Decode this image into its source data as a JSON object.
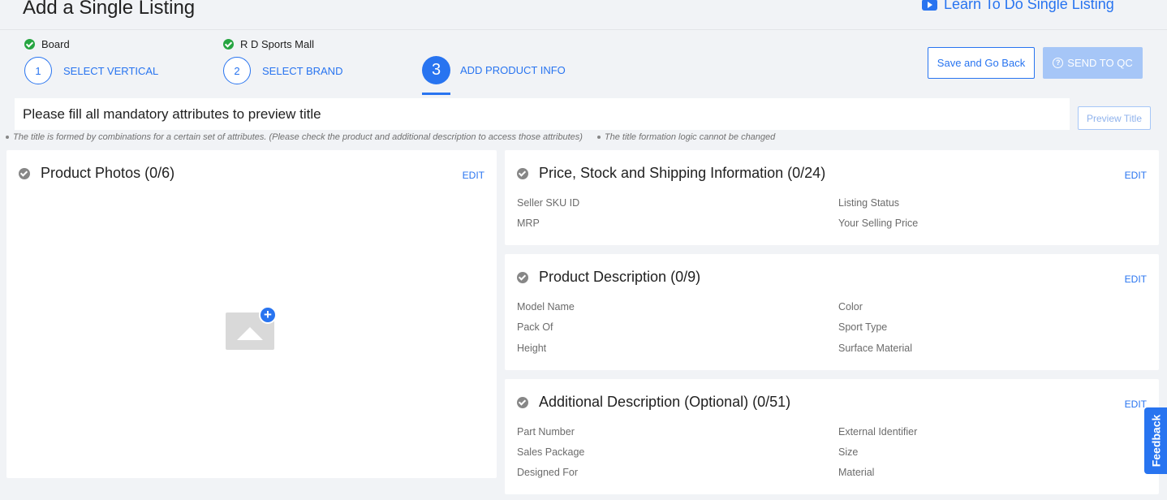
{
  "header": {
    "title": "Add a Single Listing",
    "learn_link": "Learn To Do Single Listing"
  },
  "steps": {
    "completed": [
      {
        "value": "Board"
      },
      {
        "value": "R D Sports Mall"
      }
    ],
    "items": [
      {
        "number": "1",
        "label": "SELECT VERTICAL"
      },
      {
        "number": "2",
        "label": "SELECT BRAND"
      },
      {
        "number": "3",
        "label": "ADD PRODUCT INFO"
      }
    ]
  },
  "actions": {
    "save_back": "Save and Go Back",
    "send_qc": "SEND TO QC",
    "preview_title": "Preview Title"
  },
  "title_preview": "Please fill all mandatory attributes to preview title",
  "notes": [
    "The title is formed by combinations for a certain set of attributes. (Please check the product and additional description to access those attributes)",
    "The title formation logic cannot be changed"
  ],
  "photos": {
    "title": "Product Photos (0/6)",
    "edit": "EDIT"
  },
  "price": {
    "title": "Price, Stock and Shipping Information (0/24)",
    "edit": "EDIT",
    "attributes": [
      "Seller SKU ID",
      "Listing Status",
      "MRP",
      "Your Selling Price"
    ]
  },
  "description": {
    "title": "Product Description (0/9)",
    "edit": "EDIT",
    "attributes": [
      "Model Name",
      "Color",
      "Pack Of",
      "Sport Type",
      "Height",
      "Surface Material"
    ]
  },
  "additional": {
    "title": "Additional Description (Optional) (0/51)",
    "edit": "EDIT",
    "attributes": [
      "Part Number",
      "External Identifier",
      "Sales Package",
      "Size",
      "Designed For",
      "Material"
    ]
  },
  "feedback": "Feedback",
  "colors": {
    "accent": "#2874f0",
    "success": "#26a541",
    "disabled": "#a6c6f7",
    "background": "#f1f3f6"
  }
}
